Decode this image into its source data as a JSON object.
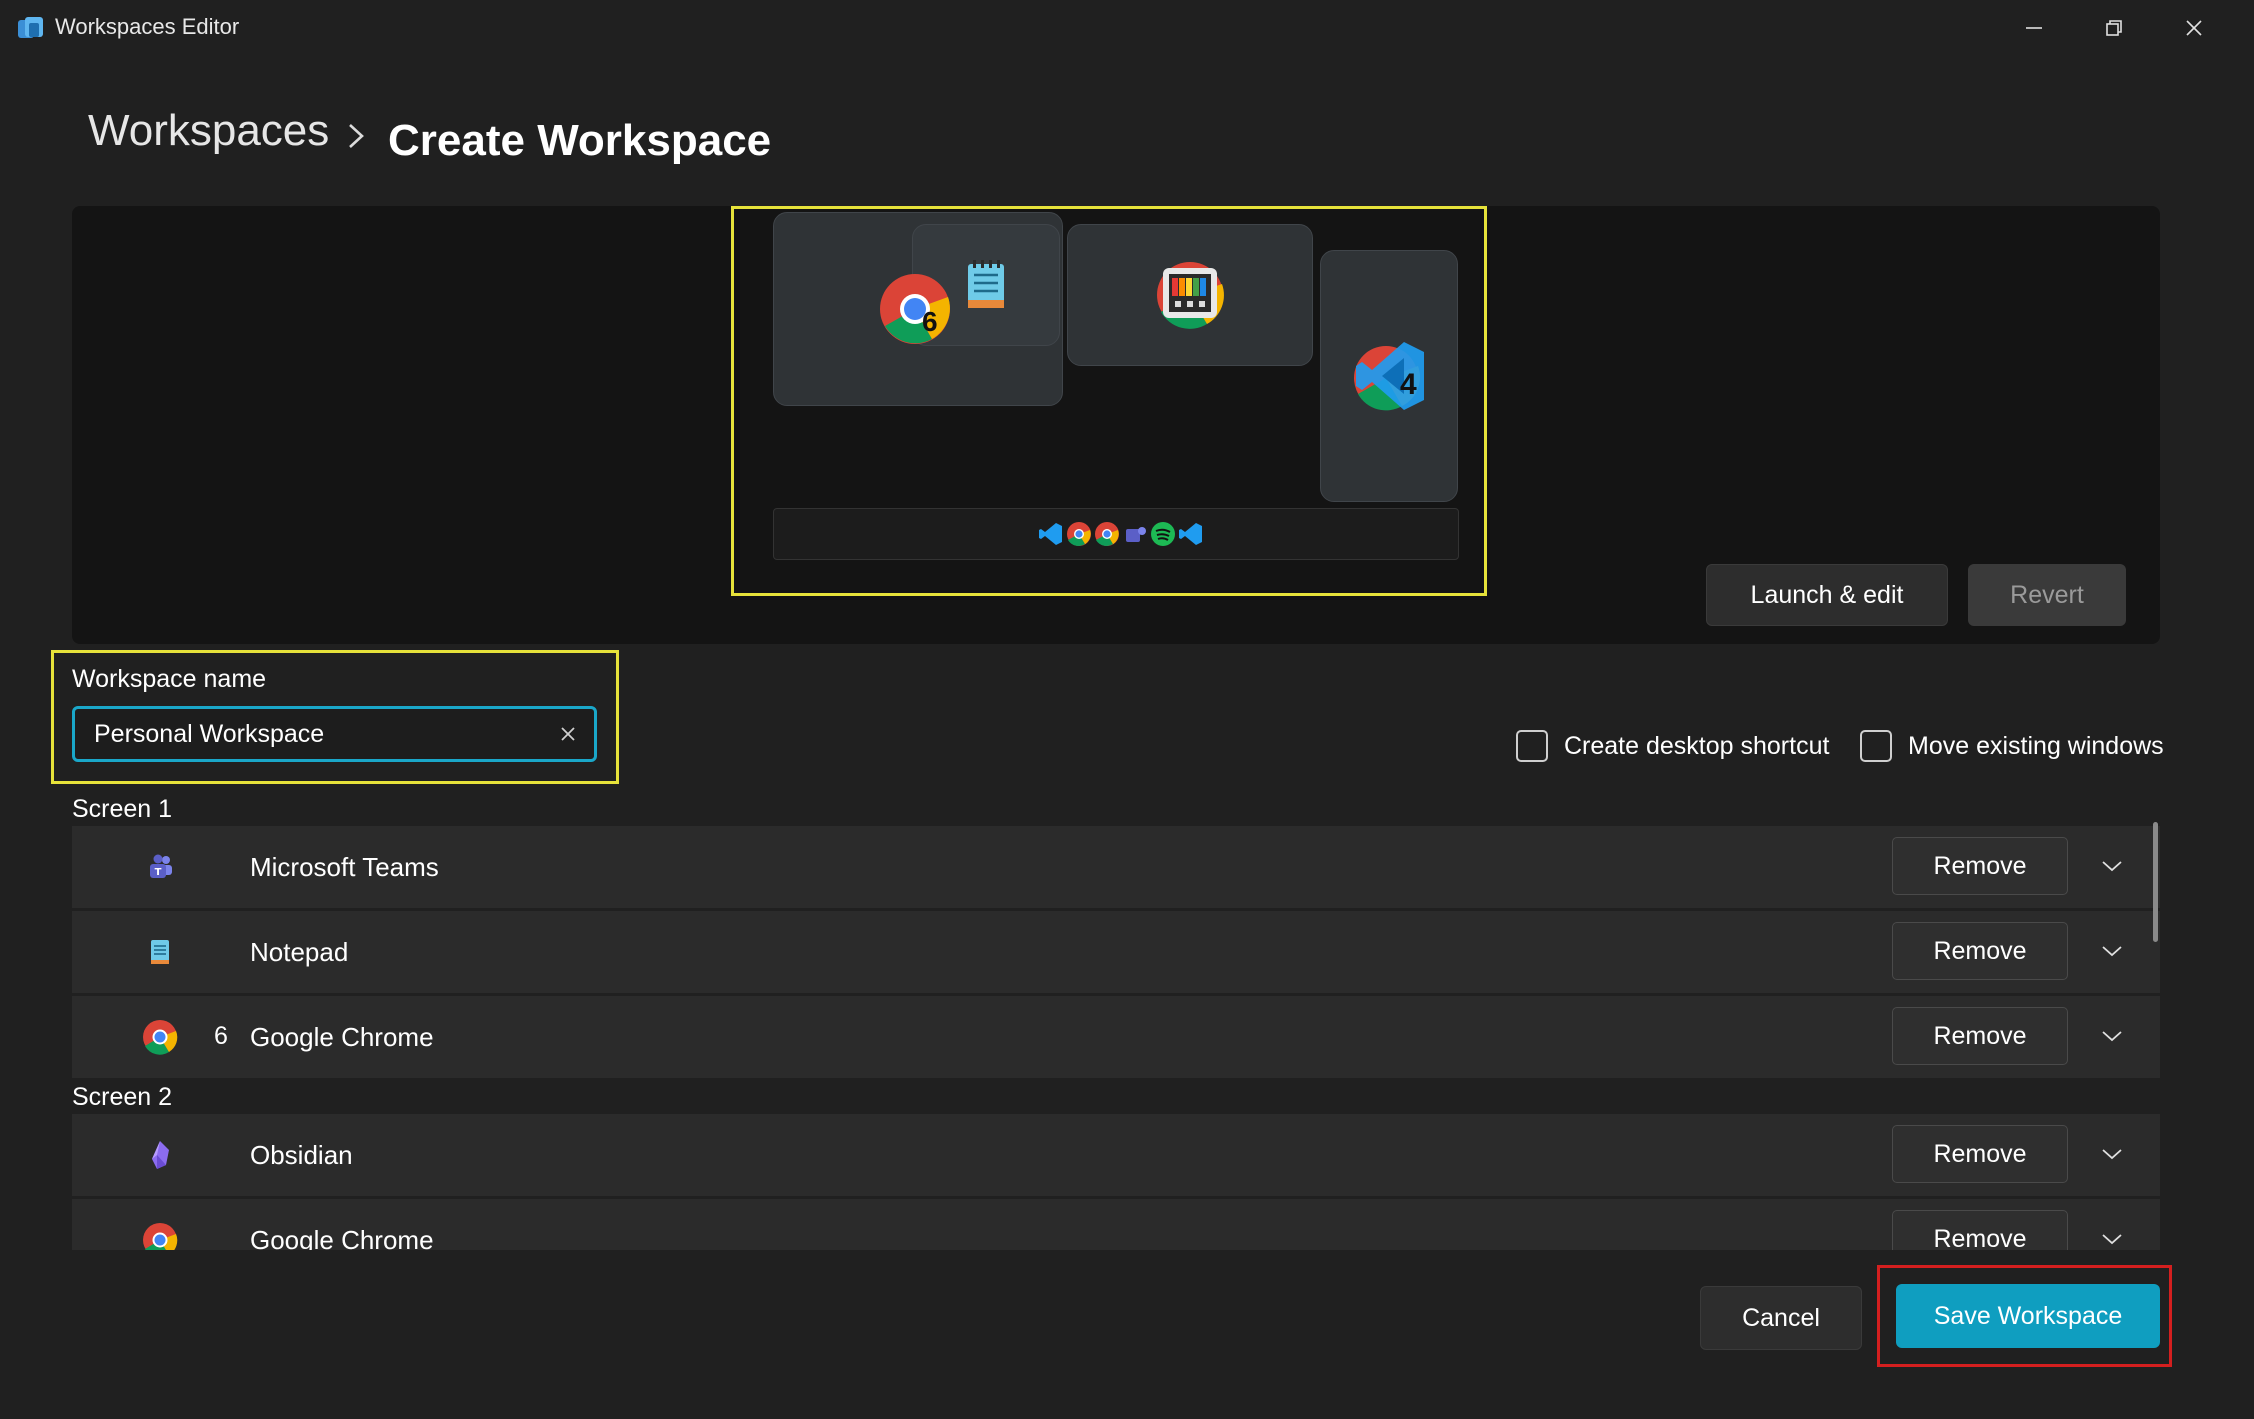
{
  "window": {
    "title": "Workspaces Editor",
    "controls": [
      "minimize-icon",
      "restore-icon",
      "close-icon"
    ]
  },
  "breadcrumb": {
    "root": "Workspaces",
    "current": "Create Workspace"
  },
  "preview": {
    "launch_edit_label": "Launch & edit",
    "revert_label": "Revert",
    "window_badges": {
      "chrome": "6",
      "vscode": "4"
    },
    "taskbar_icons": [
      "vscode-icon",
      "chrome-icon",
      "chrome-icon",
      "teams-icon",
      "spotify-icon",
      "vscode-icon"
    ]
  },
  "workspace_name": {
    "label": "Workspace name",
    "value": "Personal Workspace"
  },
  "options": {
    "create_shortcut_label": "Create desktop shortcut",
    "create_shortcut_checked": false,
    "move_windows_label": "Move existing windows",
    "move_windows_checked": false
  },
  "screens": [
    {
      "label": "Screen 1",
      "apps": [
        {
          "name": "Microsoft Teams",
          "icon": "teams-icon",
          "count": ""
        },
        {
          "name": "Notepad",
          "icon": "notepad-icon",
          "count": ""
        },
        {
          "name": "Google Chrome",
          "icon": "chrome-icon",
          "count": "6"
        }
      ]
    },
    {
      "label": "Screen 2",
      "apps": [
        {
          "name": "Obsidian",
          "icon": "obsidian-icon",
          "count": ""
        },
        {
          "name": "Google Chrome",
          "icon": "chrome-icon",
          "count": ""
        }
      ]
    }
  ],
  "row_actions": {
    "remove_label": "Remove"
  },
  "footer": {
    "cancel_label": "Cancel",
    "save_label": "Save Workspace"
  },
  "colors": {
    "background": "#202020",
    "accent": "#0f9ec0",
    "highlight_yellow": "#e6e23a",
    "highlight_red": "#d41f1f"
  }
}
